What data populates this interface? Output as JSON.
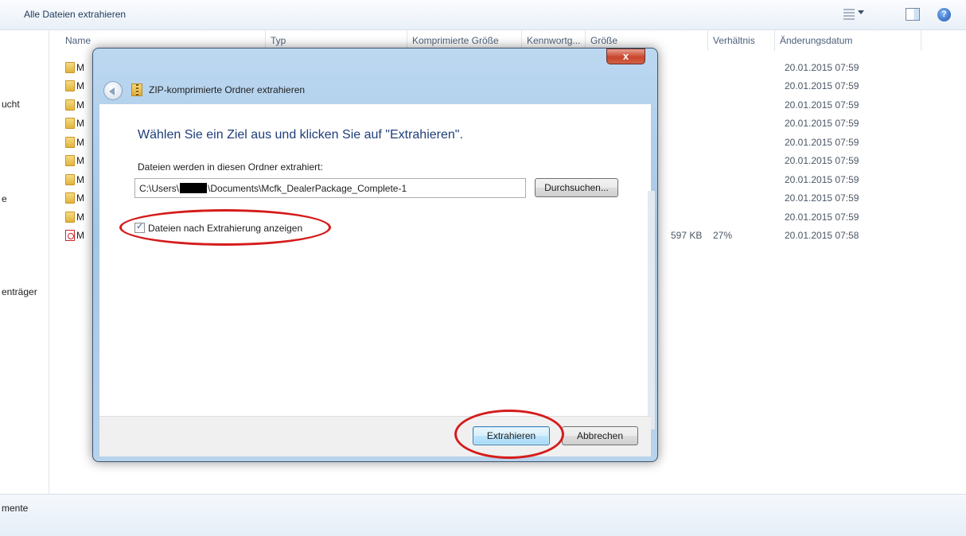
{
  "toolbar": {
    "title": "Alle Dateien extrahieren"
  },
  "columns": {
    "name": "Name",
    "type": "Typ",
    "compressed_size": "Komprimierte Größe",
    "password": "Kennwortg...",
    "size": "Größe",
    "ratio": "Verhältnis",
    "modified": "Änderungsdatum"
  },
  "nav": {
    "item1": "ucht",
    "item2": "e",
    "item3": "enträger"
  },
  "rows": [
    {
      "name_fragment": "M",
      "date": "20.01.2015 07:59"
    },
    {
      "name_fragment": "M",
      "date": "20.01.2015 07:59"
    },
    {
      "name_fragment": "M",
      "date": "20.01.2015 07:59"
    },
    {
      "name_fragment": "M",
      "date": "20.01.2015 07:59"
    },
    {
      "name_fragment": "M",
      "date": "20.01.2015 07:59"
    },
    {
      "name_fragment": "M",
      "date": "20.01.2015 07:59"
    },
    {
      "name_fragment": "M",
      "date": "20.01.2015 07:59"
    },
    {
      "name_fragment": "M",
      "date": "20.01.2015 07:59"
    },
    {
      "name_fragment": "M",
      "date": "20.01.2015 07:59"
    },
    {
      "name_fragment": "M",
      "size": "597 KB",
      "ratio": "27%",
      "date": "20.01.2015 07:58"
    }
  ],
  "status": {
    "text": "mente"
  },
  "dialog": {
    "title": "ZIP-komprimierte Ordner extrahieren",
    "close": "x",
    "instruction": "Wählen Sie ein Ziel aus und klicken Sie auf \"Extrahieren\".",
    "folder_label": "Dateien werden in diesen Ordner extrahiert:",
    "path_prefix": "C:\\Users\\",
    "path_suffix": "\\Documents\\Mcfk_DealerPackage_Complete-1",
    "browse": "Durchsuchen...",
    "show_files_label": "Dateien nach Extrahierung anzeigen",
    "show_files_checked": true,
    "extract": "Extrahieren",
    "cancel": "Abbrechen"
  },
  "help_icon": "?"
}
